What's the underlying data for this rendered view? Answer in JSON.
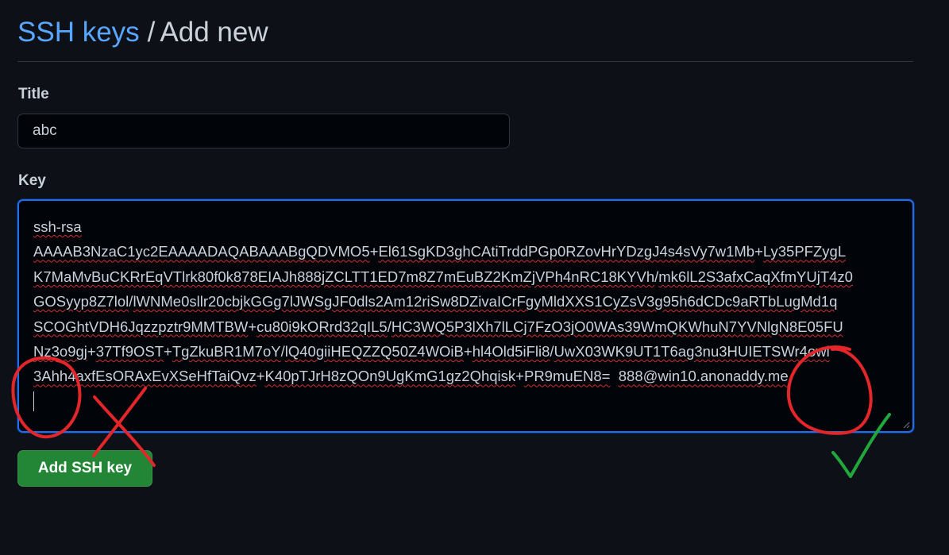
{
  "breadcrumb": {
    "link_label": "SSH keys",
    "separator": "/",
    "current_label": "Add new"
  },
  "form": {
    "title_label": "Title",
    "title_value": "abc",
    "key_label": "Key",
    "key_lines": [
      [
        "ssh-rsa"
      ],
      [
        "AAAAB3NzaC1yc2EAAAADAQABAAABgQDVMO5",
        "+",
        "El61SgKD3ghCAtiTrddPGp0RZovHrYDzgJ4s4sVy7w1Mb",
        "+",
        "Ly35PFZygL"
      ],
      [
        "K7MaMvBuCKRrEqVTlrk80f0k878EIAJh888jZCLTT1ED7m8Z7mEuBZ2KmZjVPh4nRC18KYVh",
        "/",
        "mk6lL2S3afxCaqXfmYUjT4z0"
      ],
      [
        "GOSyyp8Z7lol",
        "/",
        "lWNMe0sllr20cbjkGGg7lJWSgJF0dls2Am12riSw8DZivaICrFgyMldXXS1CyZsV3g95h6dCDc9aRTbLugMd1q"
      ],
      [
        "SCOGhtVDH6Jqzzpztr9MMTBW",
        "+",
        "cu80i9kORrd32qIL5",
        "/",
        "HC3WQ5P3lXh7lLCj7FzO3jO0WAs39WmQKWhuN7YVNlgN8E05FU"
      ],
      [
        "Nz3o9gj",
        "+",
        "37Tf9OST",
        "+",
        "TgZkuBR1M7oY",
        "/",
        "lQ40giiHEQZZQ50Z4WOiB",
        "+",
        "hl4Old5iFli8",
        "/",
        "UwX03WK9UT1T6ag3nu3HUIETSWr4owl"
      ],
      [
        "3Ahh4axfEsORAxEvXSeHfTaiQvz",
        "+",
        "K40pTJrH8zQOn9UgKmG1gz2Qhqisk",
        "+",
        "PR9muEN8=  888@win10.anonaddy.me"
      ]
    ],
    "submit_label": "Add SSH key"
  },
  "annotations": {
    "cross_color": "#e3262a",
    "circle_color": "#e3262a",
    "check_color": "#20a83c"
  }
}
